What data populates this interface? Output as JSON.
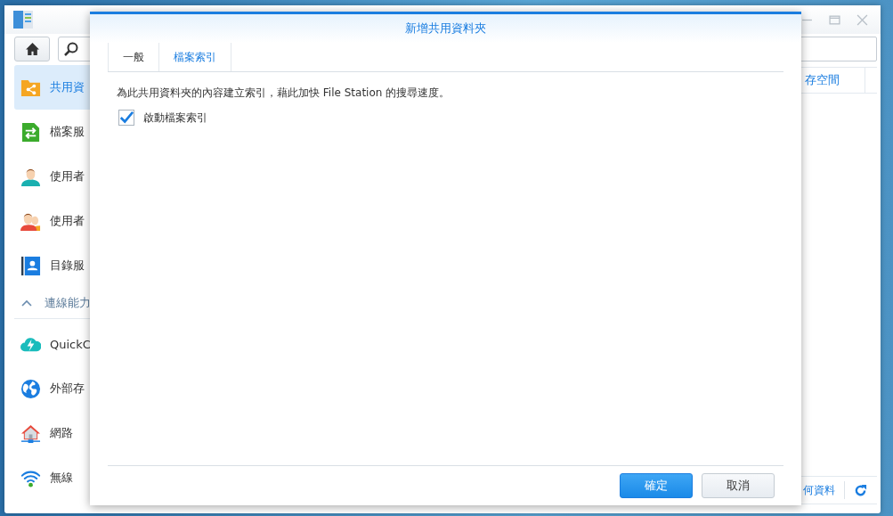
{
  "main_window": {
    "sidebar": {
      "items": [
        {
          "label": "共用資",
          "selected": true
        },
        {
          "label": "檔案服",
          "selected": false
        },
        {
          "label": "使用者",
          "selected": false
        },
        {
          "label": "使用者",
          "selected": false
        },
        {
          "label": "目錄服",
          "selected": false
        },
        {
          "kind": "section",
          "label": "連線能力",
          "expanded": true
        },
        {
          "label": "QuickC",
          "selected": false
        },
        {
          "label": "外部存",
          "selected": false
        },
        {
          "label": "網路",
          "selected": false
        },
        {
          "label": "無線",
          "selected": false
        }
      ]
    },
    "table": {
      "columns": [
        "存空間"
      ]
    },
    "status_bar": {
      "text": "何資料"
    }
  },
  "dialog": {
    "title": "新增共用資料夾",
    "tabs": [
      {
        "label": "一般",
        "selected": false
      },
      {
        "label": "檔案索引",
        "selected": true
      }
    ],
    "description": "為此共用資料夾的內容建立索引，藉此加快 File Station 的搜尋速度。",
    "checkbox": {
      "label": "啟動檔案索引",
      "checked": true
    },
    "buttons": [
      {
        "label": "確定",
        "kind": "primary"
      },
      {
        "label": "取消",
        "kind": "secondary"
      }
    ]
  }
}
